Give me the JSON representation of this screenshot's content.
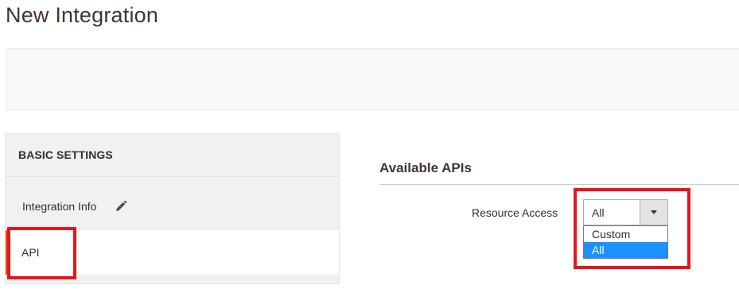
{
  "page": {
    "title": "New Integration"
  },
  "tabs": {
    "heading": "BASIC SETTINGS",
    "items": [
      {
        "label": "Integration Info",
        "icon": "pencil-icon"
      },
      {
        "label": "API",
        "active": true
      }
    ]
  },
  "api_section": {
    "title": "Available APIs",
    "resource_access": {
      "label": "Resource Access",
      "selected": "All",
      "options": [
        "Custom",
        "All"
      ],
      "highlighted_option": "All"
    }
  },
  "colors": {
    "accent": "#eb5202",
    "highlight_border": "#e8141b",
    "option_selected": "#1e90ff"
  }
}
